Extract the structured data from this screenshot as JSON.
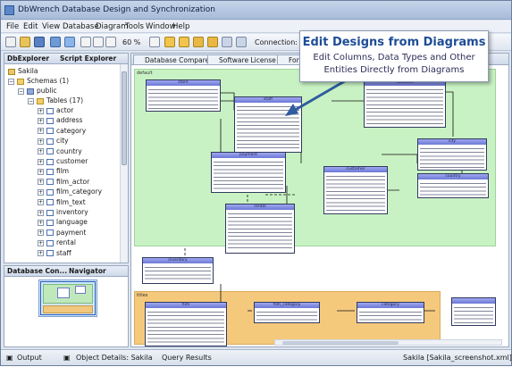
{
  "window": {
    "title": "DbWrench Database Design and Synchronization"
  },
  "menu": [
    "File",
    "Edit",
    "View",
    "Database",
    "Diagram",
    "Tools",
    "Window",
    "Help"
  ],
  "toolbar": {
    "zoom": "60 %",
    "connection_label": "Connection:"
  },
  "left_panel": {
    "tabs": [
      "DbExplorer",
      "Script Explorer"
    ],
    "tree": {
      "root": "Sakila",
      "schemas": "Schemas (1)",
      "schema": "public",
      "tables": "Tables (17)",
      "items": [
        "actor",
        "address",
        "category",
        "city",
        "country",
        "customer",
        "film",
        "film_actor",
        "film_category",
        "film_text",
        "inventory",
        "language",
        "payment",
        "rental",
        "staff"
      ]
    }
  },
  "nav_panel": {
    "tabs": [
      "Database Con...",
      "Navigator"
    ]
  },
  "content_tabs": [
    "Database Compare",
    "Software License",
    "For"
  ],
  "diagram": {
    "green_area_label": "default",
    "orange_area_label": "titles",
    "entities": [
      "store",
      "staff",
      "address",
      "payment",
      "city",
      "customer",
      "country",
      "inventory",
      "rental",
      "film",
      "film_category",
      "category"
    ]
  },
  "statusbar": {
    "items": [
      "Output",
      "Object Details: Sakila",
      "Query Results"
    ],
    "right": "Sakila [Sakila_screenshot.xml]"
  },
  "callout": {
    "title": "Edit Designs from Diagrams",
    "lines": [
      "Edit Columns, Data Types and Other",
      "Entities Directly from Diagrams"
    ]
  },
  "colors": {
    "accent": "#1d4d96",
    "green_area": "#c9f2c4",
    "orange_area": "#f5c97c",
    "entity_header": "#8b95e8"
  }
}
